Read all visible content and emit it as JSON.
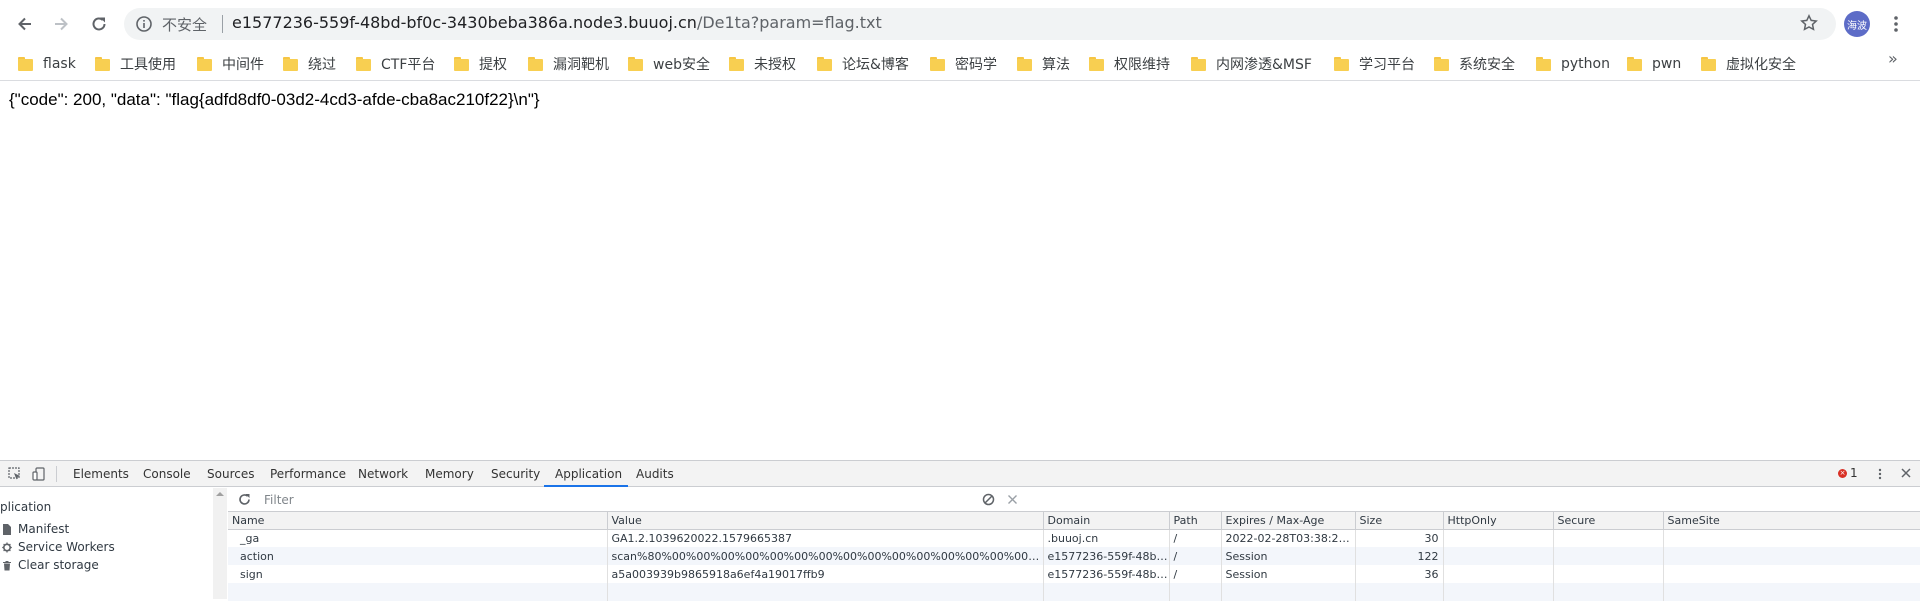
{
  "browser": {
    "insecure_label": "不安全",
    "url_host": "e1577236-559f-48bd-bf0c-3430beba386a.node3.buuoj.cn",
    "url_path": "/De1ta?param=flag.txt",
    "profile_initials": "海波"
  },
  "bookmarks": [
    {
      "label": "flask"
    },
    {
      "label": "工具使用"
    },
    {
      "label": "中间件"
    },
    {
      "label": "绕过"
    },
    {
      "label": "CTF平台"
    },
    {
      "label": "提权"
    },
    {
      "label": "漏洞靶机"
    },
    {
      "label": "web安全"
    },
    {
      "label": "未授权"
    },
    {
      "label": "论坛&博客"
    },
    {
      "label": "密码学"
    },
    {
      "label": "算法"
    },
    {
      "label": "权限维持"
    },
    {
      "label": "内网渗透&MSF"
    },
    {
      "label": "学习平台"
    },
    {
      "label": "系统安全"
    },
    {
      "label": "python"
    },
    {
      "label": "pwn"
    },
    {
      "label": "虚拟化安全"
    }
  ],
  "page": {
    "body_text": "{\"code\": 200, \"data\": \"flag{adfd8df0-03d2-4cd3-afde-cba8ac210f22}\\n\"}"
  },
  "devtools": {
    "tabs": [
      "Elements",
      "Console",
      "Sources",
      "Performance",
      "Network",
      "Memory",
      "Security",
      "Application",
      "Audits"
    ],
    "active_tab": "Application",
    "error_count": "1",
    "sidebar": {
      "title": "plication",
      "items": [
        "Manifest",
        "Service Workers",
        "Clear storage"
      ]
    },
    "filter_placeholder": "Filter",
    "columns": [
      "Name",
      "Value",
      "Domain",
      "Path",
      "Expires / Max-Age",
      "Size",
      "HttpOnly",
      "Secure",
      "SameSite"
    ],
    "rows": [
      {
        "name": "_ga",
        "value": "GA1.2.1039620022.1579665387",
        "domain": ".buuoj.cn",
        "path": "/",
        "expires": "2022-02-28T03:38:28....",
        "size": "30",
        "httponly": "",
        "secure": "",
        "samesite": ""
      },
      {
        "name": "action",
        "value": "scan%80%00%00%00%00%00%00%00%00%00%00%00%00%00%00%00%00%00%00%00%00%00%...",
        "domain": "e1577236-559f-48bd-bf0...",
        "path": "/",
        "expires": "Session",
        "size": "122",
        "httponly": "",
        "secure": "",
        "samesite": ""
      },
      {
        "name": "sign",
        "value": "a5a003939b9865918a6ef4a19017ffb9",
        "domain": "e1577236-559f-48bd-bf0...",
        "path": "/",
        "expires": "Session",
        "size": "36",
        "httponly": "",
        "secure": "",
        "samesite": ""
      }
    ]
  },
  "colors": {
    "accent": "#1a73e8",
    "folder": "#f8cf51",
    "avatar": "#5d6cc7",
    "error": "#d93025"
  }
}
